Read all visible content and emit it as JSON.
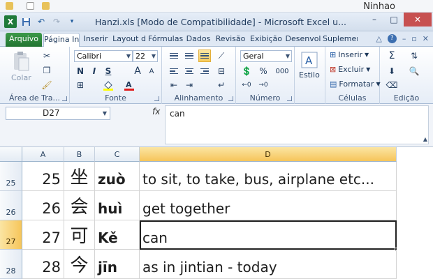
{
  "app": {
    "title": "Hanzi.xls [Modo de Compatibilidade] - Microsoft Excel u...",
    "user": "Ninhao",
    "excel_badge": "X",
    "close_glyph": "✕",
    "min_glyph": "–",
    "max_glyph": "□"
  },
  "tabs": {
    "file": "Arquivo",
    "items": [
      "Página In",
      "Inserir",
      "Layout d",
      "Fórmulas",
      "Dados",
      "Revisão",
      "Exibição",
      "Desenvol",
      "Suplemer"
    ]
  },
  "ribbon": {
    "clipboard": {
      "label": "Área de Tra...",
      "paste": "Colar"
    },
    "font": {
      "label": "Fonte",
      "name": "Calibri",
      "size": "22",
      "bold": "N",
      "italic": "I",
      "underline": "S",
      "grow": "A",
      "shrink": "A"
    },
    "alignment": {
      "label": "Alinhamento"
    },
    "number": {
      "label": "Número",
      "format": "Geral",
      "percent": "%",
      "thousands": "000"
    },
    "styles": {
      "label": "Estilo"
    },
    "cells": {
      "label": "Células",
      "insert": "Inserir",
      "delete": "Excluir",
      "format": "Formatar"
    },
    "editing": {
      "label": "Edição"
    }
  },
  "formula_bar": {
    "name_box": "D27",
    "fx": "fx",
    "content": "can"
  },
  "grid": {
    "columns": [
      "A",
      "B",
      "C",
      "D"
    ],
    "active_column": "D",
    "active_row": "27",
    "rows": [
      {
        "row": "25",
        "a": "25",
        "b": "坐",
        "c": "zuò",
        "d": "to sit, to take, bus, airplane etc..."
      },
      {
        "row": "26",
        "a": "26",
        "b": "会",
        "c": "huì",
        "d": "get together"
      },
      {
        "row": "27",
        "a": "27",
        "b": "可",
        "c": "Kě",
        "d": "can"
      },
      {
        "row": "28",
        "a": "28",
        "b": "今",
        "c": "jīn",
        "d": "as in jintian - today"
      }
    ]
  },
  "colors": {
    "file_tab": "#227431",
    "active_header": "#f6c55a",
    "selected_button": "#f8cd5d",
    "close_button": "#c75050"
  }
}
